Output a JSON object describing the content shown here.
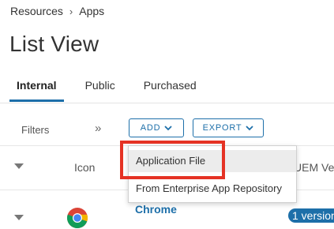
{
  "breadcrumb": {
    "items": [
      "Resources",
      "Apps"
    ],
    "separator": "›"
  },
  "page": {
    "title": "List View"
  },
  "tabs": [
    {
      "label": "Internal",
      "active": true
    },
    {
      "label": "Public",
      "active": false
    },
    {
      "label": "Purchased",
      "active": false
    }
  ],
  "toolbar": {
    "filters_label": "Filters",
    "expand_glyph": "»",
    "add_label": "ADD",
    "export_label": "EXPORT"
  },
  "table": {
    "columns": {
      "icon": "Icon",
      "uem": "UEM Ver"
    },
    "rows": [
      {
        "name": "Chrome",
        "sub": "",
        "icon": "chrome-icon",
        "version_badge": "1 version"
      }
    ]
  },
  "add_menu": {
    "items": [
      {
        "label": "Application File",
        "highlighted": true
      },
      {
        "label": "From Enterprise App Repository",
        "highlighted": false
      }
    ]
  },
  "colors": {
    "accent": "#1d6fa9",
    "annotation": "#e53224"
  }
}
